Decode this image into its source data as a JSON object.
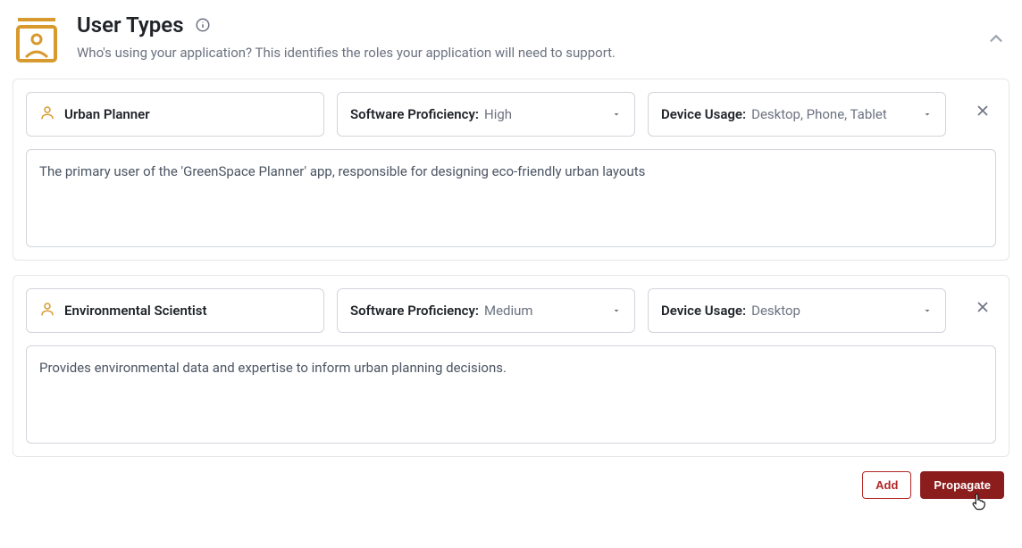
{
  "header": {
    "title": "User Types",
    "subtitle": "Who's using your application? This identifies the roles your application will need to support."
  },
  "labels": {
    "softwareProficiency": "Software Proficiency:",
    "deviceUsage": "Device Usage:"
  },
  "actions": {
    "add": "Add",
    "propagate": "Propagate"
  },
  "userTypes": [
    {
      "name": "Urban Planner",
      "proficiency": "High",
      "devices": "Desktop, Phone, Tablet",
      "description": "The primary user of the 'GreenSpace Planner' app, responsible for designing eco-friendly urban layouts"
    },
    {
      "name": "Environmental Scientist",
      "proficiency": "Medium",
      "devices": "Desktop",
      "description": "Provides environmental data and expertise to inform urban planning decisions."
    }
  ]
}
